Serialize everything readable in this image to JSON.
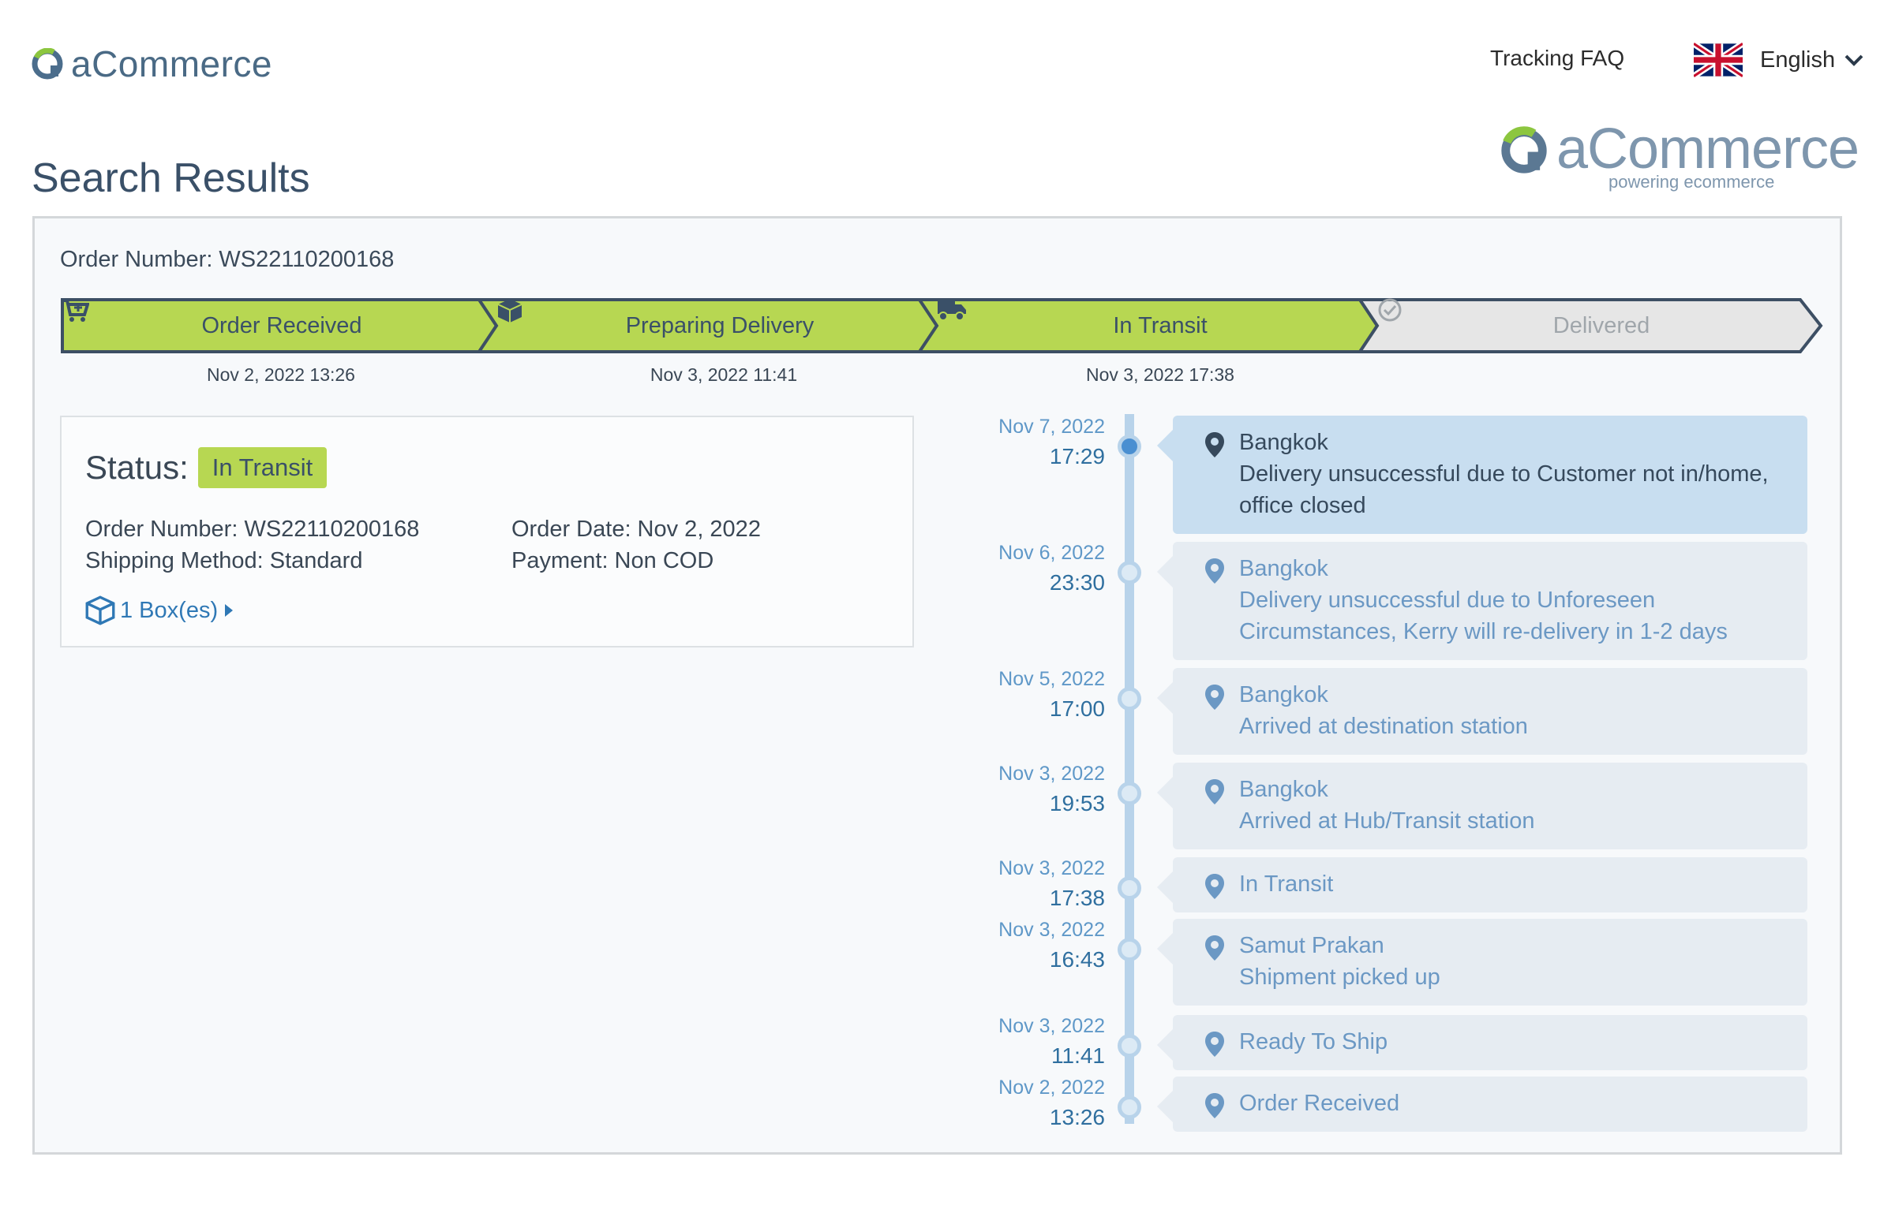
{
  "header": {
    "logo_text": "aCommerce",
    "faq_link": "Tracking FAQ",
    "language": "English"
  },
  "page": {
    "title": "Search Results",
    "brand_logo_text": "aCommerce",
    "brand_tagline": "powering ecommerce"
  },
  "order": {
    "label": "Order Number:",
    "number": "WS22110200168"
  },
  "steps": [
    {
      "label": "Order Received",
      "date": "Nov 2, 2022 13:26",
      "state": "done",
      "icon": "cart-icon"
    },
    {
      "label": "Preparing Delivery",
      "date": "Nov 3, 2022 11:41",
      "state": "done",
      "icon": "box-icon"
    },
    {
      "label": "In Transit",
      "date": "Nov 3, 2022 17:38",
      "state": "done",
      "icon": "truck-icon"
    },
    {
      "label": "Delivered",
      "date": "",
      "state": "pending",
      "icon": "check-circle-icon"
    }
  ],
  "status": {
    "label": "Status:",
    "value": "In Transit",
    "order_number": "Order Number: WS22110200168",
    "shipping_method": "Shipping Method: Standard",
    "order_date": "Order Date: Nov 2, 2022",
    "payment": "Payment: Non COD",
    "boxes": "1 Box(es)"
  },
  "timeline": [
    {
      "date": "Nov 7, 2022",
      "time": "17:29",
      "location": "Bangkok",
      "description": "Delivery unsuccessful due to Customer not in/home, office closed",
      "active": true
    },
    {
      "date": "Nov 6, 2022",
      "time": "23:30",
      "location": "Bangkok",
      "description": "Delivery unsuccessful due to Unforeseen Circumstances, Kerry will re-delivery in 1-2 days",
      "active": false
    },
    {
      "date": "Nov 5, 2022",
      "time": "17:00",
      "location": "Bangkok",
      "description": "Arrived at destination station",
      "active": false
    },
    {
      "date": "Nov 3, 2022",
      "time": "19:53",
      "location": "Bangkok",
      "description": "Arrived at Hub/Transit station",
      "active": false
    },
    {
      "date": "Nov 3, 2022",
      "time": "17:38",
      "location": "In Transit",
      "description": "",
      "active": false
    },
    {
      "date": "Nov 3, 2022",
      "time": "16:43",
      "location": "Samut Prakan",
      "description": "Shipment picked up",
      "active": false
    },
    {
      "date": "Nov 3, 2022",
      "time": "11:41",
      "location": "Ready To Ship",
      "description": "",
      "active": false
    },
    {
      "date": "Nov 2, 2022",
      "time": "13:26",
      "location": "Order Received",
      "description": "",
      "active": false
    }
  ],
  "colors": {
    "done": "#b7d752",
    "pending": "#e6e6e6",
    "outline": "#3d4f64",
    "timeline_active": "#c8def0",
    "timeline_item": "#e6ecf2",
    "link": "#2f78b5"
  }
}
